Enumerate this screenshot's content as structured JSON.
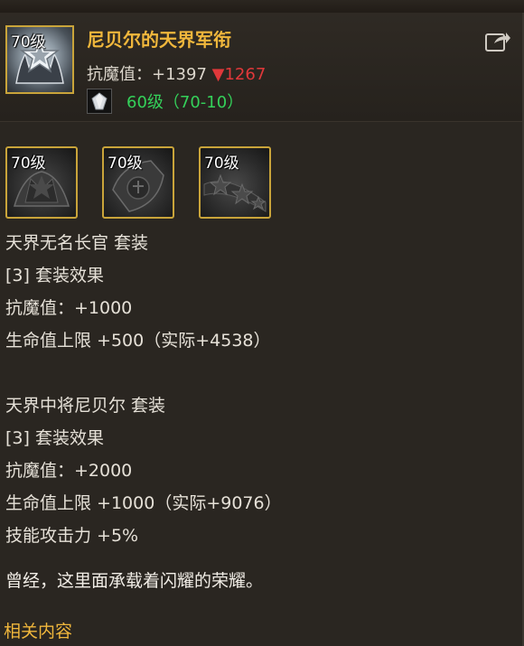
{
  "item": {
    "level_badge": "70级",
    "name": "尼贝尔的天界军衔",
    "stat_label": "抗魔值：+1397",
    "stat_change": "▼1267",
    "gem_text": "60级（70-10）"
  },
  "set_icons": [
    {
      "level_badge": "70级"
    },
    {
      "level_badge": "70级"
    },
    {
      "level_badge": "70级"
    }
  ],
  "set1": {
    "title": "天界无名长官  套装",
    "effect_header": "[3] 套装效果",
    "stat1": "抗魔值：+1000",
    "stat2": "生命值上限 +500（实际+4538）"
  },
  "set2": {
    "title": "天界中将尼贝尔  套装",
    "effect_header": "[3] 套装效果",
    "stat1": "抗魔值：+2000",
    "stat2": "生命值上限 +1000（实际+9076）",
    "stat3": "技能攻击力 +5%"
  },
  "flavor": "曾经，这里面承载着闪耀的荣耀。",
  "related": "相关内容",
  "colors": {
    "name": "#f0b73c",
    "stat_down": "#e0383a",
    "gem": "#34d15a",
    "frame": "#c9a43a"
  },
  "icons": [
    "rank-insignia-icon",
    "gem-icon",
    "share-icon",
    "set-helmet-icon",
    "set-shoulder-icon",
    "set-stars-icon"
  ]
}
